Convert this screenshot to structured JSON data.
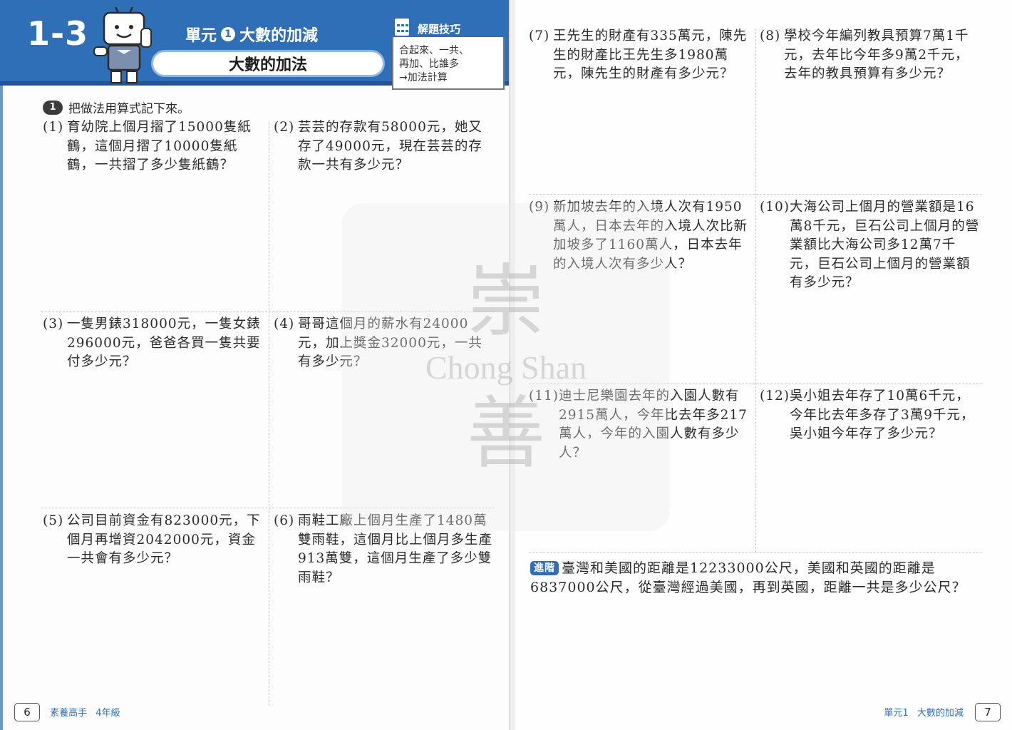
{
  "header": {
    "lesson_number": "1-3",
    "unit_title": "單元",
    "unit_index": "1",
    "unit_topic": "大數的加減",
    "lesson_title": "大數的加法",
    "tip_title": "解題技巧",
    "tip_lines": [
      "合起來、一共、",
      "再加、比誰多",
      "→加法計算"
    ]
  },
  "instruction": {
    "badge": "1",
    "text": "把做法用算式記下來。"
  },
  "problems": [
    {
      "num": "(1)",
      "text": "育幼院上個月摺了15000隻紙鶴，這個月摺了10000隻紙鶴，一共摺了多少隻紙鶴？"
    },
    {
      "num": "(2)",
      "text": "芸芸的存款有58000元，她又存了49000元，現在芸芸的存款一共有多少元？"
    },
    {
      "num": "(3)",
      "text": "一隻男錶318000元，一隻女錶296000元，爸爸各買一隻共要付多少元？"
    },
    {
      "num": "(4)",
      "text": "哥哥這個月的薪水有24000元，加上獎金32000元，一共有多少元？"
    },
    {
      "num": "(5)",
      "text": "公司目前資金有823000元，下個月再增資2042000元，資金一共會有多少元？"
    },
    {
      "num": "(6)",
      "text": "雨鞋工廠上個月生產了1480萬雙雨鞋，這個月比上個月多生產913萬雙，這個月生產了多少雙雨鞋？"
    },
    {
      "num": "(7)",
      "text": "王先生的財產有335萬元，陳先生的財產比王先生多1980萬元，陳先生的財產有多少元？"
    },
    {
      "num": "(8)",
      "text": "學校今年編列教具預算7萬1千元，去年比今年多9萬2千元，去年的教具預算有多少元？"
    },
    {
      "num": "(9)",
      "text": "新加坡去年的入境人次有1950萬人，日本去年的入境人次比新加坡多了1160萬人，日本去年的入境人次有多少人？"
    },
    {
      "num": "(10)",
      "text": "大海公司上個月的營業額是16萬8千元，巨石公司上個月的營業額比大海公司多12萬7千元，巨石公司上個月的營業額有多少元？"
    },
    {
      "num": "(11)",
      "text": "迪士尼樂園去年的入園人數有2915萬人，今年比去年多217萬人，今年的入園人數有多少人？"
    },
    {
      "num": "(12)",
      "text": "吳小姐去年存了10萬6千元，今年比去年多存了3萬9千元，吳小姐今年存了多少元？"
    }
  ],
  "advanced": {
    "badge": "進階",
    "text": "臺灣和美國的距離是12233000公尺，美國和英國的距離是6837000公尺，從臺灣經過美國，再到英國，距離一共是多少公尺？"
  },
  "footer_left": {
    "page": "6",
    "book": "素養高手",
    "grade": "4年級"
  },
  "footer_right": {
    "page": "7",
    "unit": "單元1",
    "topic": "大數的加減"
  },
  "watermark": {
    "top_char": "崇",
    "text": "Chong Shan",
    "bottom_char": "善"
  },
  "colors": {
    "brand_blue": "#2f6fb8"
  }
}
